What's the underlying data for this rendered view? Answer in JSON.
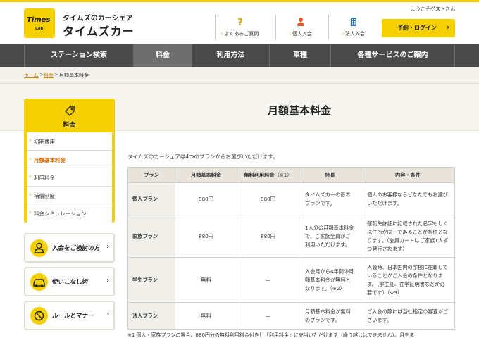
{
  "header": {
    "logo_text": "Times",
    "logo_sub": "CAR",
    "brand_sub": "タイムズのカーシェア",
    "brand_main": "タイムズカー",
    "welcome_prefix": "ようこそ",
    "welcome_name": "ゲスト",
    "welcome_suffix": "さん",
    "links": [
      {
        "label": "よくあるご質問",
        "icon": "question-icon"
      },
      {
        "label": "個人入会",
        "icon": "person-icon"
      },
      {
        "label": "法人入会",
        "icon": "building-icon"
      }
    ],
    "reserve_button": "予約・ログイン",
    "reserve_chevron": "›"
  },
  "nav": {
    "items": [
      {
        "label": "ステーション検索"
      },
      {
        "label": "料金"
      },
      {
        "label": "利用方法"
      },
      {
        "label": "車種"
      },
      {
        "label": "各種サービスのご案内"
      }
    ]
  },
  "breadcrumb": {
    "home": "ホーム",
    "sep": ">",
    "parent": "料金",
    "current": "月額基本料金"
  },
  "page": {
    "title": "月額基本料金",
    "intro": "タイムズのカーシェアは4つのプランからお選びいただけます。"
  },
  "sidebar": {
    "title": "料金",
    "arrow": "›",
    "items": [
      {
        "label": "初期費用"
      },
      {
        "label": "月額基本料金"
      },
      {
        "label": "利用料金"
      },
      {
        "label": "補償制度"
      },
      {
        "label": "料金シミュレーション"
      }
    ]
  },
  "cta": {
    "chevron": "›",
    "items": [
      {
        "label": "入会をご検討の方",
        "icon": "person-badge-icon"
      },
      {
        "label": "使いこなし術",
        "icon": "car-icon"
      },
      {
        "label": "ルールとマナー",
        "icon": "prohibition-icon"
      }
    ]
  },
  "plan_table": {
    "headers": [
      "プラン",
      "月額基本料金",
      "無料利用料金",
      "特長",
      "内容・条件"
    ],
    "free_header_note": "（※1）",
    "rows": [
      {
        "plan": "個人プラン",
        "monthly": "880円",
        "free": "880円",
        "feature": "タイムズカーの基本プランです。",
        "conditions": "個人のお客様ならどなたでもお選びいただけます。"
      },
      {
        "plan": "家族プラン",
        "monthly": "880円",
        "free": "880円",
        "feature": "1人分の月額基本料金で、ご家族全員がご利用いただけます。",
        "conditions": "運転免許証に記載された名字もしくは住所が同一であることが条件となります。（会員カードはご家族1人ずつ発行されます）"
      },
      {
        "plan": "学生プラン",
        "monthly": "無料",
        "free": "—",
        "feature": "入会月から4年間の月額基本料金が無料となります。（※2）",
        "conditions": "入会時、日本国内の学校に在籍していることがご入会の条件となります。（学生証、在学証明書などが必要です）（※3）"
      },
      {
        "plan": "法人プラン",
        "monthly": "無料",
        "free": "—",
        "feature": "月額基本料金が無料のプランです。",
        "conditions": "ご入会の際には当社指定の審査がございます。"
      }
    ]
  },
  "footnote": "※1 個人・家族プランの場合、880円分の無料利用料金付き！「利用料金」に充当いただけます（繰り越しはできません）。月をま"
}
